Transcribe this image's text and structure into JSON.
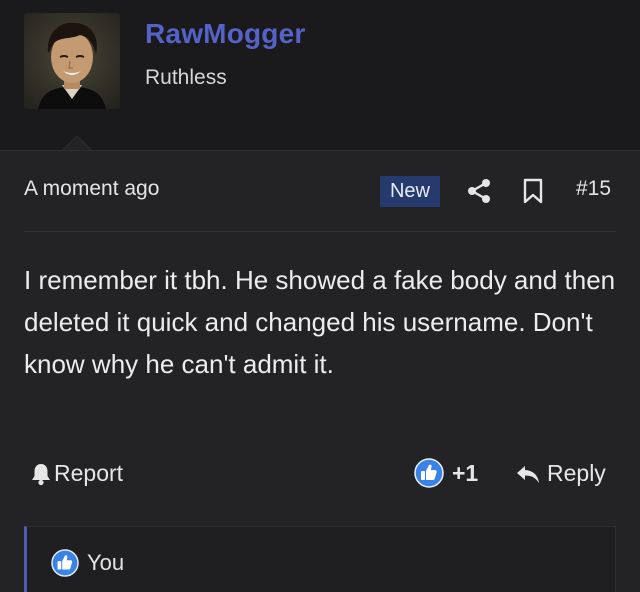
{
  "user": {
    "name": "RawMogger",
    "title": "Ruthless",
    "name_color": "#5563c8"
  },
  "post": {
    "timestamp": "A moment ago",
    "badge": "New",
    "number": "#15",
    "message": "I remember it tbh. He showed a fake body and then deleted it quick and changed his username. Don't know why he can't admit it."
  },
  "actions": {
    "report_label": "Report",
    "reaction_count": "+1",
    "reply_label": "Reply"
  },
  "reactions": {
    "reactor_label": "You"
  },
  "icons": {
    "share": "share-icon",
    "bookmark": "bookmark-icon",
    "report": "bell-icon",
    "like": "thumbs-up-icon",
    "reply": "reply-arrow-icon"
  },
  "colors": {
    "accent": "#4f5bb5",
    "badge_bg": "#263a6e",
    "like_blue": "#3b82e6"
  }
}
